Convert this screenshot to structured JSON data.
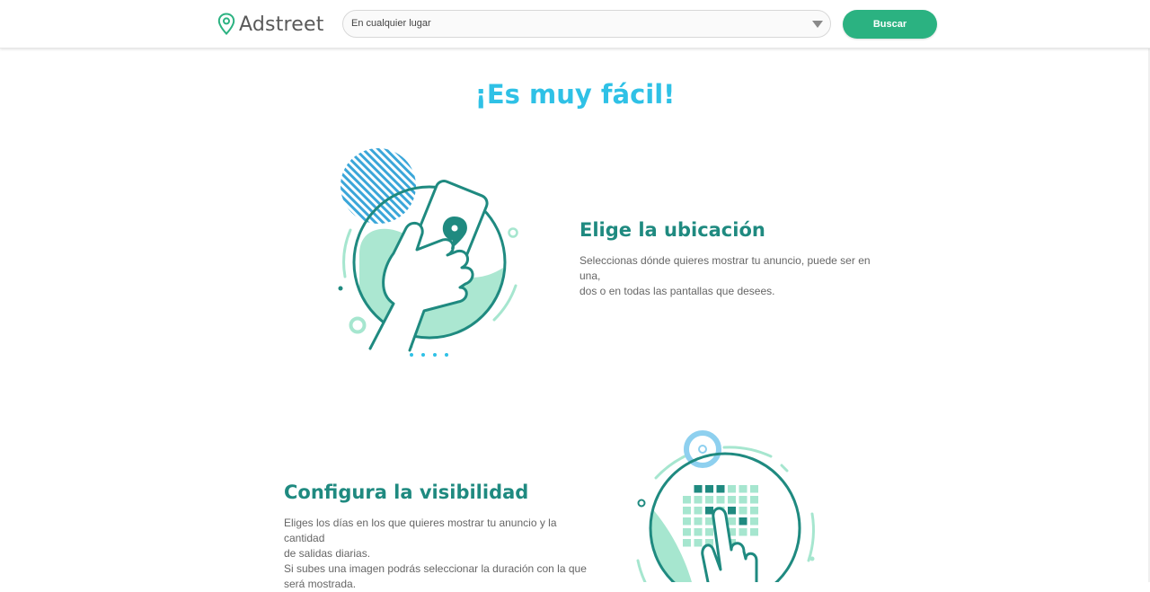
{
  "header": {
    "brand": "Adstreet",
    "location_select": {
      "value": "En cualquier lugar"
    },
    "search_button": "Buscar"
  },
  "main": {
    "title": "¡Es muy fácil!",
    "steps": [
      {
        "title": "Elige la ubicación",
        "description": [
          "Seleccionas dónde quieres mostrar tu anuncio, puede ser en una,",
          "dos o en todas las pantallas que desees."
        ]
      },
      {
        "title": "Configura la visibilidad",
        "description": [
          "Eliges los días en los que quieres mostrar tu anuncio y la cantidad",
          "de salidas diarias.",
          "Si subes una imagen podrás seleccionar la duración con la que",
          "será mostrada."
        ]
      }
    ]
  },
  "colors": {
    "brand_green": "#2bb281",
    "title_cyan": "#2fc1e6",
    "heading_teal": "#1f8a80",
    "illustration_mint": "#a6e6cf"
  },
  "icons": [
    "location-pin-icon",
    "dropdown-arrow-icon",
    "phone-location-illustration",
    "calendar-touch-illustration"
  ]
}
